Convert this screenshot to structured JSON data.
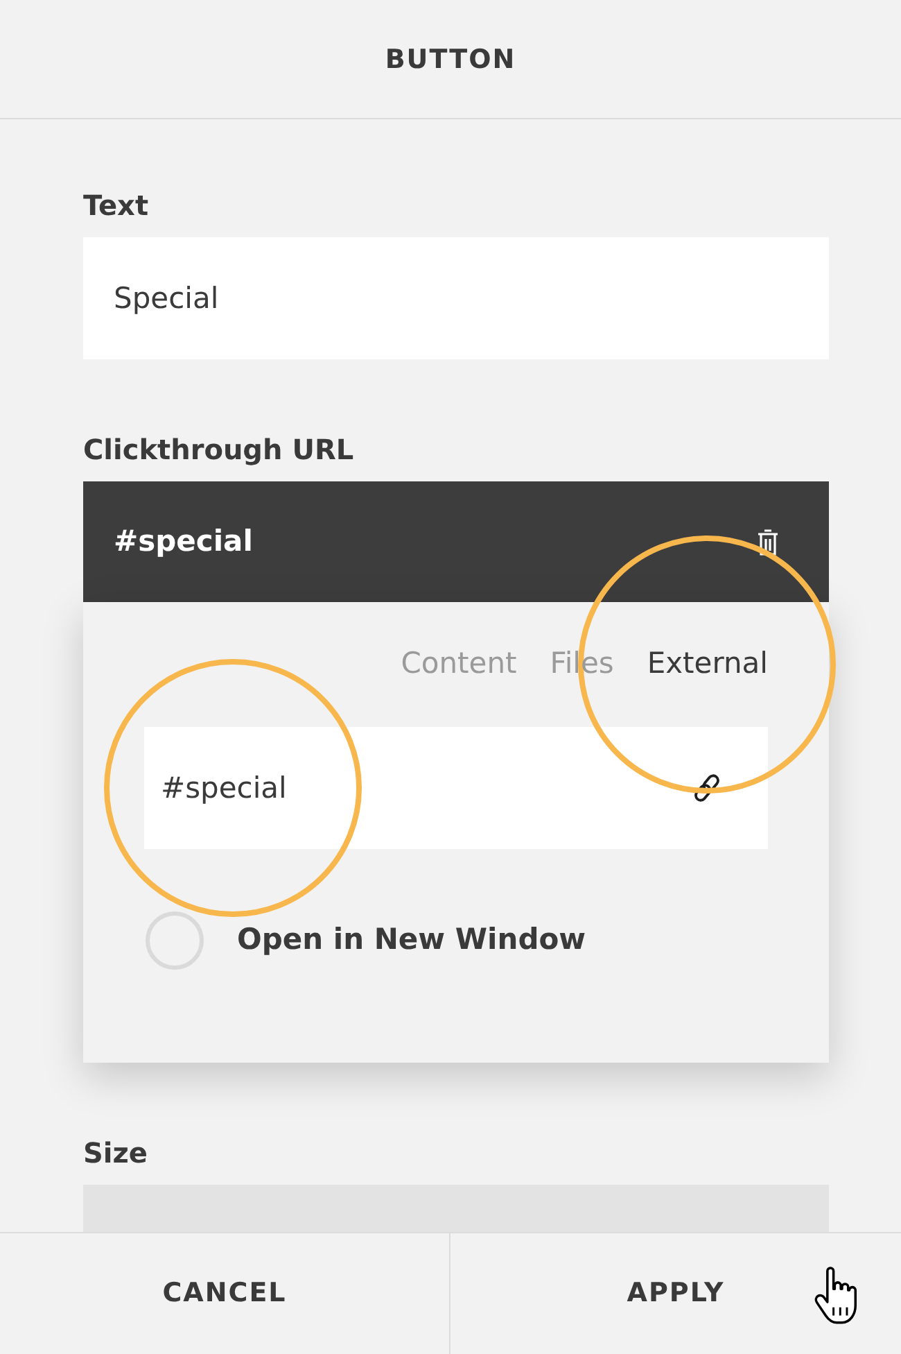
{
  "header": {
    "title": "BUTTON"
  },
  "text_field": {
    "label": "Text",
    "value": "Special"
  },
  "url_field": {
    "label": "Clickthrough URL",
    "value": "#special"
  },
  "link_popover": {
    "tabs": [
      {
        "label": "Content",
        "selected": false,
        "highlighted": false
      },
      {
        "label": "Files",
        "selected": false,
        "highlighted": false
      },
      {
        "label": "External",
        "selected": true,
        "highlighted": true
      }
    ],
    "input": {
      "value": "#special",
      "highlighted": true
    },
    "open_in_new_window": {
      "label": "Open in New Window",
      "checked": false
    }
  },
  "size_field": {
    "label": "Size"
  },
  "footer": {
    "buttons": [
      {
        "label": "CANCEL",
        "hovered": false
      },
      {
        "label": "APPLY",
        "hovered": true
      }
    ]
  }
}
